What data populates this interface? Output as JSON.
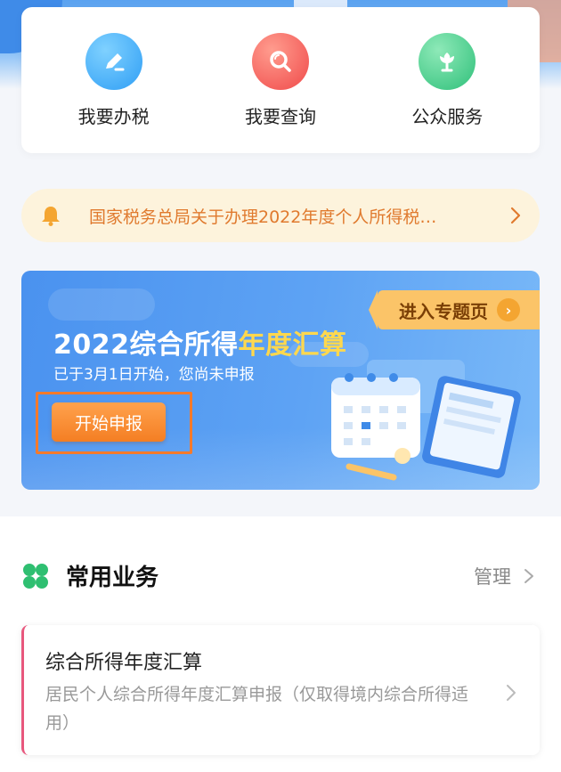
{
  "quick_actions": [
    {
      "label": "我要办税",
      "icon": "pen-edit-icon"
    },
    {
      "label": "我要查询",
      "icon": "search-icon"
    },
    {
      "label": "公众服务",
      "icon": "flower-service-icon"
    }
  ],
  "notice": {
    "text": "国家税务总局关于办理2022年度个人所得税…",
    "icon": "bell-icon"
  },
  "banner": {
    "enter_label": "进入专题页",
    "title_prefix": "2022综合所得",
    "title_highlight": "年度汇算",
    "subtitle": "已于3月1日开始，您尚未申报",
    "start_button": "开始申报"
  },
  "common_business": {
    "title": "常用业务",
    "manage_label": "管理",
    "items": [
      {
        "title": "综合所得年度汇算",
        "description": "居民个人综合所得年度汇算申报（仅取得境内综合所得适用）"
      }
    ]
  },
  "colors": {
    "accent_orange": "#f47e23",
    "notice_text": "#e07a2e",
    "banner_blue": "#4a92ef",
    "highlight_yellow": "#ffd84d",
    "section_icon_green": "#2fbf71",
    "card_accent": "#e8577d"
  }
}
